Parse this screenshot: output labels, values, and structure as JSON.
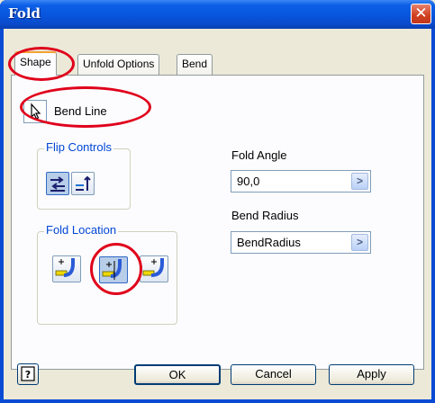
{
  "window": {
    "title": "Fold",
    "close_glyph": "✕"
  },
  "tabs": [
    {
      "label": "Shape",
      "active": true
    },
    {
      "label": "Unfold Options",
      "active": false
    },
    {
      "label": "Bend",
      "active": false
    }
  ],
  "shape": {
    "bend_line_label": "Bend Line",
    "flip_controls_title": "Flip Controls",
    "fold_location_title": "Fold Location",
    "fold_angle_label": "Fold Angle",
    "fold_angle_value": "90,0",
    "bend_radius_label": "Bend Radius",
    "bend_radius_value": "BendRadius",
    "arrow_glyph": ">"
  },
  "buttons": {
    "ok": "OK",
    "cancel": "Cancel",
    "apply": "Apply",
    "help_glyph": "?"
  },
  "icons": [
    "cursor-arrow-icon",
    "flip-side-icon",
    "flip-direction-icon",
    "fold-location-left-icon",
    "fold-location-centerline-icon",
    "fold-location-right-icon",
    "help-icon",
    "close-icon"
  ],
  "colors": {
    "title_bar": "#0855dd",
    "close_button": "#cf3e1f",
    "group_title": "#0046d5",
    "callout": "#e0001b",
    "active_tab_accent": "#f3a235"
  }
}
